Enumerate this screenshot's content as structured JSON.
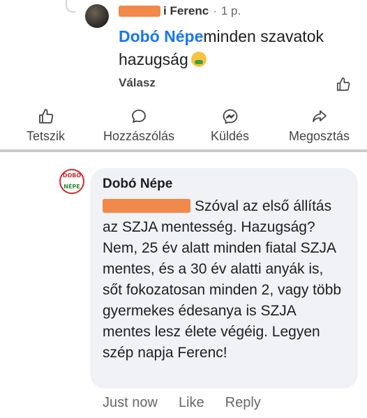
{
  "reply": {
    "author": "i Ferenc",
    "time": "1 p.",
    "mention": "Dobó Népe",
    "text": "minden szavatok hazugság",
    "emoji": "nauseated-face-icon",
    "action": "Válasz"
  },
  "post_actions": {
    "like": "Tetszik",
    "comment": "Hozzászólás",
    "send": "Küldés",
    "share": "Megosztás"
  },
  "comment": {
    "author": "Dobó Népe",
    "avatar_top": "DOBÓ",
    "avatar_bottom": "NÉPE",
    "text": "Szóval az első állítás az SZJA mentesség. Hazugság? Nem, 25 év alatt minden fiatal SZJA mentes, és a 30 év alatti anyák is, sőt fokozatosan minden 2, vagy több gyermekes édesanya is SZJA mentes lesz élete végéig. Legyen szép napja Ferenc!",
    "time": "Just now",
    "like": "Like",
    "reply": "Reply"
  },
  "colors": {
    "accent": "#1877f2",
    "bubble": "#f0f2f5",
    "redaction": "#f0894a",
    "muted": "#65676b"
  }
}
